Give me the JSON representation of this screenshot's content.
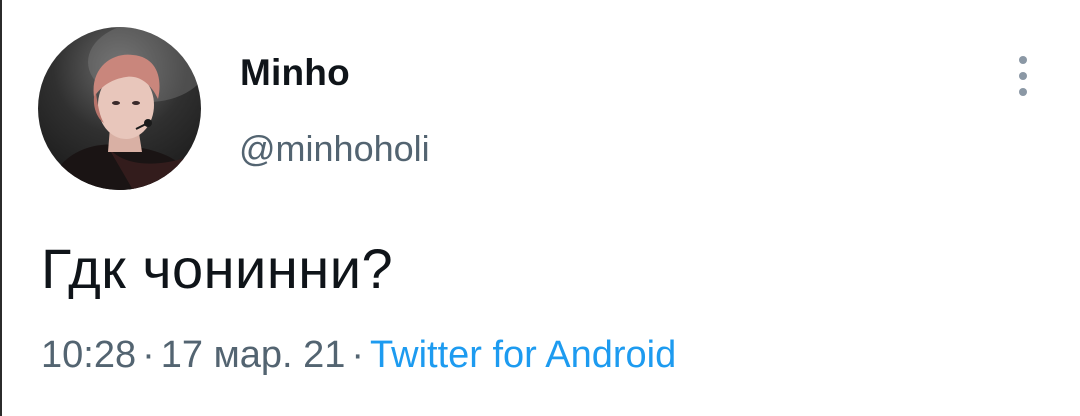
{
  "author": {
    "display_name": "Minho",
    "handle": "@minhoholi"
  },
  "tweet": {
    "text": "Гдк чонинни?",
    "time": "10:28",
    "date": "17 мар. 21",
    "separator": "·",
    "source": "Twitter for Android"
  },
  "icons": {
    "more": "more-vertical-icon"
  },
  "colors": {
    "name": "#0f1419",
    "secondary": "#536471",
    "link": "#1d9bf0",
    "icon": "#8b98a5"
  }
}
